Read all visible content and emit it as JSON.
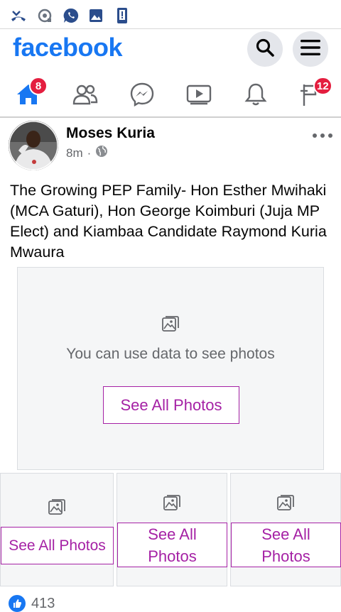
{
  "status_bar": {
    "icons": [
      "missed-call-icon",
      "data-saver-icon",
      "whatsapp-icon",
      "gallery-icon",
      "phone-update-icon"
    ]
  },
  "header": {
    "logo": "facebook",
    "search_icon": "search-icon",
    "menu_icon": "hamburger-menu-icon"
  },
  "nav": {
    "items": [
      {
        "name": "home",
        "icon": "home-icon",
        "badge": "8",
        "active": true
      },
      {
        "name": "friends",
        "icon": "friends-icon",
        "badge": ""
      },
      {
        "name": "messenger",
        "icon": "messenger-icon",
        "badge": ""
      },
      {
        "name": "watch",
        "icon": "video-icon",
        "badge": ""
      },
      {
        "name": "notifications",
        "icon": "bell-icon",
        "badge": ""
      },
      {
        "name": "marketplace",
        "icon": "flag-icon",
        "badge": "12"
      }
    ]
  },
  "post": {
    "author": "Moses Kuria",
    "time": "8m",
    "separator": "·",
    "privacy_icon": "globe-icon",
    "text": "The Growing PEP Family- Hon Esther Mwihaki (MCA Gaturi), Hon George Koimburi (Juja MP Elect) and Kiambaa Candidate Raymond Kuria Mwaura",
    "photo_main": {
      "message": "You can use data to see photos",
      "button": "See All Photos"
    },
    "photo_cells": [
      {
        "button": "See All Photos"
      },
      {
        "button": "See All Photos"
      },
      {
        "button": "See All Photos"
      }
    ],
    "reaction_count": "413"
  },
  "colors": {
    "brand_blue": "#1877f2",
    "badge_red": "#e41e3f",
    "button_purple": "#a521a5",
    "muted_text": "#65676b"
  }
}
